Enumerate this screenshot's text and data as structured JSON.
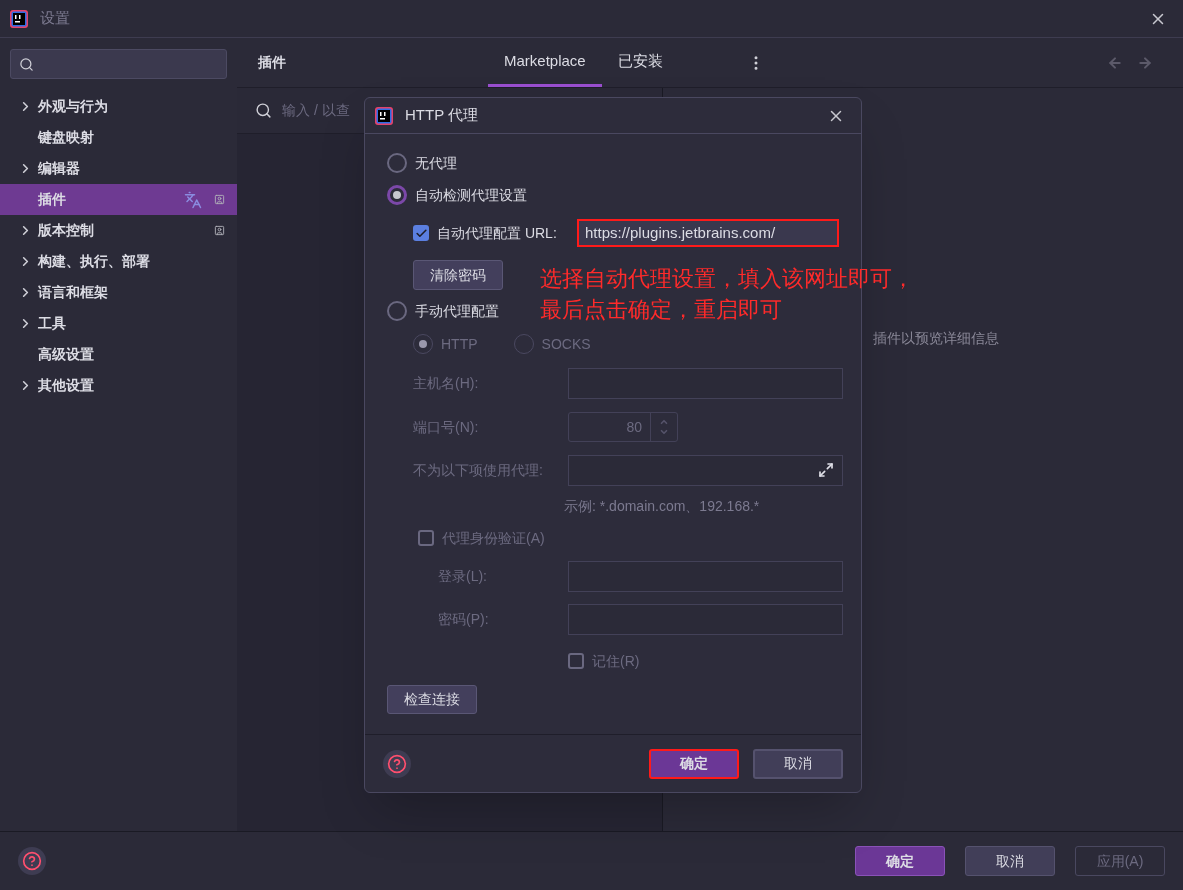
{
  "window": {
    "title": "设置"
  },
  "sidebar": {
    "items": [
      {
        "label": "外观与行为",
        "expandable": true,
        "selected": false,
        "translate_mark": false,
        "profile_mark": false
      },
      {
        "label": "键盘映射",
        "expandable": false,
        "selected": false,
        "translate_mark": false,
        "profile_mark": false
      },
      {
        "label": "编辑器",
        "expandable": true,
        "selected": false,
        "translate_mark": false,
        "profile_mark": false
      },
      {
        "label": "插件",
        "expandable": false,
        "selected": true,
        "translate_mark": true,
        "profile_mark": true
      },
      {
        "label": "版本控制",
        "expandable": true,
        "selected": false,
        "translate_mark": false,
        "profile_mark": true
      },
      {
        "label": "构建、执行、部署",
        "expandable": true,
        "selected": false,
        "translate_mark": false,
        "profile_mark": false
      },
      {
        "label": "语言和框架",
        "expandable": true,
        "selected": false,
        "translate_mark": false,
        "profile_mark": false
      },
      {
        "label": "工具",
        "expandable": true,
        "selected": false,
        "translate_mark": false,
        "profile_mark": false
      },
      {
        "label": "高级设置",
        "expandable": false,
        "selected": false,
        "translate_mark": false,
        "profile_mark": false
      },
      {
        "label": "其他设置",
        "expandable": true,
        "selected": false,
        "translate_mark": false,
        "profile_mark": false
      }
    ]
  },
  "main": {
    "title": "插件",
    "tabs": [
      {
        "label": "Marketplace",
        "selected": true
      },
      {
        "label": "已安装",
        "selected": false
      }
    ],
    "search": {
      "placeholder": "输入 / 以查"
    },
    "detail_hint": "插件以预览详细信息"
  },
  "dialog": {
    "title": "HTTP 代理",
    "modes": [
      {
        "label": "无代理",
        "selected": false
      },
      {
        "label": "自动检测代理设置",
        "selected": true
      },
      {
        "label": "手动代理配置",
        "selected": false
      }
    ],
    "auto": {
      "checkbox": {
        "label": "自动代理配置 URL:",
        "checked": true
      },
      "url": "https://plugins.jetbrains.com/",
      "url_highlighted": true,
      "clear_button": "清除密码"
    },
    "manual": {
      "disabled": true,
      "protocols": [
        {
          "label": "HTTP",
          "selected": true
        },
        {
          "label": "SOCKS",
          "selected": false
        }
      ],
      "host": {
        "label": "主机名(H):"
      },
      "port": {
        "label": "端口号(N):",
        "value": "80"
      },
      "no_proxy": {
        "label": "不为以下项使用代理:",
        "hint": "示例: *.domain.com、192.168.*"
      },
      "auth": {
        "label": "代理身份验证(A)",
        "checked": false
      },
      "login": {
        "label": "登录(L):"
      },
      "password": {
        "label": "密码(P):"
      },
      "remember": {
        "label": "记住(R)",
        "checked": false
      }
    },
    "check_button": "检查连接",
    "buttons": [
      {
        "label": "确定",
        "primary": true,
        "highlighted": true
      },
      {
        "label": "取消",
        "primary": false,
        "highlighted": false
      }
    ]
  },
  "annotation": [
    "选择自动代理设置，填入该网址即可，",
    "最后点击确定，重启即可"
  ],
  "footer": {
    "buttons": [
      {
        "label": "确定",
        "primary": true,
        "disabled": false
      },
      {
        "label": "取消",
        "primary": false,
        "disabled": false
      },
      {
        "label": "应用(A)",
        "primary": false,
        "disabled": true
      }
    ]
  }
}
